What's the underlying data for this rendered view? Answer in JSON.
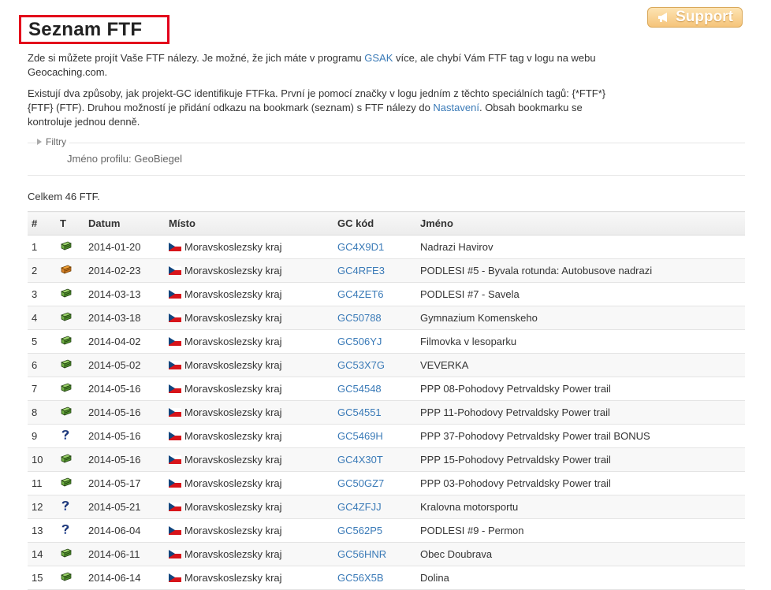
{
  "support_label": "Support",
  "page_title": "Seznam FTF",
  "intro": {
    "p1_before": "Zde si můžete projít Vaše FTF nálezy. Je možné, že jich máte v programu ",
    "p1_link": "GSAK",
    "p1_after": " více, ale chybí Vám FTF tag v logu na webu Geocaching.com.",
    "p2_before": "Existují dva způsoby, jak projekt-GC identifikuje FTFka. První je pomocí značky v logu jedním z těchto speciálních tagů: {*FTF*} {FTF} (FTF). Druhou možností je přidání odkazu na bookmark (seznam) s FTF nálezy do ",
    "p2_link": "Nastavení",
    "p2_after": ". Obsah bookmarku se kontroluje jednou denně."
  },
  "filters_label": "Filtry",
  "profile_line": "Jméno profilu: GeoBiegel",
  "total": "Celkem 46 FTF.",
  "columns": [
    "#",
    "T",
    "Datum",
    "Místo",
    "GC kód",
    "Jméno"
  ],
  "rows": [
    {
      "n": "1",
      "type": "traditional-cache-icon",
      "date": "2014-01-20",
      "place": "Moravskoslezsky kraj",
      "code": "GC4X9D1",
      "name": "Nadrazi Havirov"
    },
    {
      "n": "2",
      "type": "multi-cache-icon",
      "date": "2014-02-23",
      "place": "Moravskoslezsky kraj",
      "code": "GC4RFE3",
      "name": "PODLESI #5 - Byvala rotunda: Autobusove nadrazi"
    },
    {
      "n": "3",
      "type": "traditional-cache-icon",
      "date": "2014-03-13",
      "place": "Moravskoslezsky kraj",
      "code": "GC4ZET6",
      "name": "PODLESI #7 - Savela"
    },
    {
      "n": "4",
      "type": "traditional-cache-icon",
      "date": "2014-03-18",
      "place": "Moravskoslezsky kraj",
      "code": "GC50788",
      "name": "Gymnazium Komenskeho"
    },
    {
      "n": "5",
      "type": "traditional-cache-icon",
      "date": "2014-04-02",
      "place": "Moravskoslezsky kraj",
      "code": "GC506YJ",
      "name": "Filmovka v lesoparku"
    },
    {
      "n": "6",
      "type": "traditional-cache-icon",
      "date": "2014-05-02",
      "place": "Moravskoslezsky kraj",
      "code": "GC53X7G",
      "name": "VEVERKA"
    },
    {
      "n": "7",
      "type": "traditional-cache-icon",
      "date": "2014-05-16",
      "place": "Moravskoslezsky kraj",
      "code": "GC54548",
      "name": "PPP 08-Pohodovy Petrvaldsky Power trail"
    },
    {
      "n": "8",
      "type": "traditional-cache-icon",
      "date": "2014-05-16",
      "place": "Moravskoslezsky kraj",
      "code": "GC54551",
      "name": "PPP 11-Pohodovy Petrvaldsky Power trail"
    },
    {
      "n": "9",
      "type": "mystery-cache-icon",
      "date": "2014-05-16",
      "place": "Moravskoslezsky kraj",
      "code": "GC5469H",
      "name": "PPP 37-Pohodovy Petrvaldsky Power trail BONUS"
    },
    {
      "n": "10",
      "type": "traditional-cache-icon",
      "date": "2014-05-16",
      "place": "Moravskoslezsky kraj",
      "code": "GC4X30T",
      "name": "PPP 15-Pohodovy Petrvaldsky Power trail"
    },
    {
      "n": "11",
      "type": "traditional-cache-icon",
      "date": "2014-05-17",
      "place": "Moravskoslezsky kraj",
      "code": "GC50GZ7",
      "name": "PPP 03-Pohodovy Petrvaldsky Power trail"
    },
    {
      "n": "12",
      "type": "mystery-cache-icon",
      "date": "2014-05-21",
      "place": "Moravskoslezsky kraj",
      "code": "GC4ZFJJ",
      "name": "Kralovna motorsportu"
    },
    {
      "n": "13",
      "type": "mystery-cache-icon",
      "date": "2014-06-04",
      "place": "Moravskoslezsky kraj",
      "code": "GC562P5",
      "name": "PODLESI #9 - Permon"
    },
    {
      "n": "14",
      "type": "traditional-cache-icon",
      "date": "2014-06-11",
      "place": "Moravskoslezsky kraj",
      "code": "GC56HNR",
      "name": "Obec Doubrava"
    },
    {
      "n": "15",
      "type": "traditional-cache-icon",
      "date": "2014-06-14",
      "place": "Moravskoslezsky kraj",
      "code": "GC56X5B",
      "name": "Dolina"
    }
  ]
}
